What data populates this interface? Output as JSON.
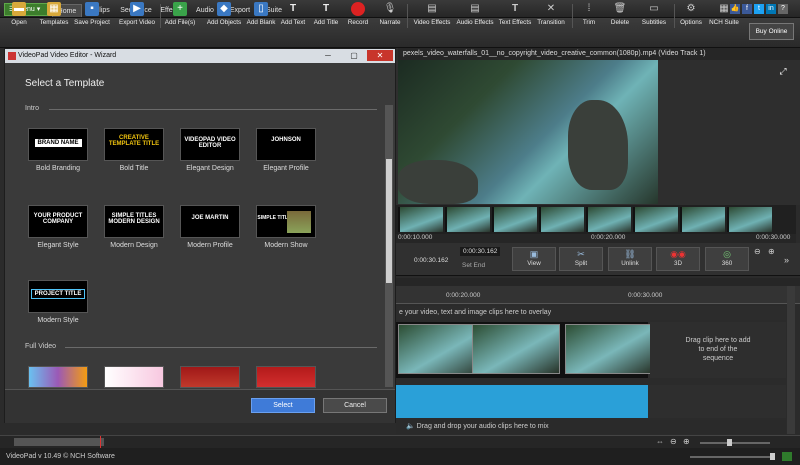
{
  "menu": {
    "menu_button": "Menu",
    "tabs": [
      "Home",
      "Clips",
      "Sequence",
      "Effects",
      "Audio",
      "Export",
      "Suite"
    ]
  },
  "toolbar": {
    "items": [
      "Open",
      "Templates",
      "Save Project",
      "Export Video",
      "Add File(s)",
      "Add Objects",
      "Add Blank",
      "Add Text",
      "Add Title",
      "Record",
      "Narrate",
      "Video Effects",
      "Audio Effects",
      "Text Effects",
      "Transition",
      "Trim",
      "Delete",
      "Subtitles",
      "Options",
      "NCH Suite"
    ],
    "buy_online": "Buy Online"
  },
  "dialog": {
    "title": "VideoPad Video Editor - Wizard",
    "heading": "Select a Template",
    "sections": [
      {
        "name": "Intro",
        "templates": [
          {
            "label": "Bold Branding",
            "thumb_text": "BRAND NAME"
          },
          {
            "label": "Bold Title",
            "thumb_text": "CREATIVE TEMPLATE TITLE"
          },
          {
            "label": "Elegant Design",
            "thumb_text": "VIDEOPAD VIDEO EDITOR"
          },
          {
            "label": "Elegant Profile",
            "thumb_text": "JOHNSON"
          },
          {
            "label": "Elegant Style",
            "thumb_text": "YOUR PRODUCT COMPANY"
          },
          {
            "label": "Modern Design",
            "thumb_text": "SIMPLE TITLES MODERN DESIGN"
          },
          {
            "label": "Modern Profile",
            "thumb_text": "JOE MARTIN"
          },
          {
            "label": "Modern Show",
            "thumb_text": "SIMPLE TITLES"
          },
          {
            "label": "Modern Style",
            "thumb_text": "PROJECT TITLE"
          }
        ]
      },
      {
        "name": "Full Video"
      }
    ],
    "select": "Select",
    "cancel": "Cancel"
  },
  "preview": {
    "title": "pexels_video_waterfalls_01__no_copyright_video_creative_common(1080p).mp4 (Video Track 1)",
    "scrub_times": [
      "0:00:10.000",
      "0:00:20.000",
      "0:00:30.000"
    ],
    "time_start": "0:00:30.162",
    "time_field": "0:00:30.162",
    "set_end": "Set End",
    "buttons": [
      "View",
      "Split",
      "Unlink",
      "3D",
      "360"
    ]
  },
  "timeline": {
    "ruler": [
      "0:00:20.000",
      "0:00:30.000"
    ],
    "overlay_hint": "e your video, text and image clips here to overlay",
    "drag_add": [
      "Drag clip here to add",
      "to end of the",
      "sequence"
    ],
    "audio_hint": "Drag and drop your audio clips here to mix"
  },
  "status": "VideoPad v 10.49 © NCH Software",
  "colors": {
    "accent": "#3f7bd8",
    "audio": "#2aa0d8",
    "menu_green": "#3c7d2c"
  }
}
